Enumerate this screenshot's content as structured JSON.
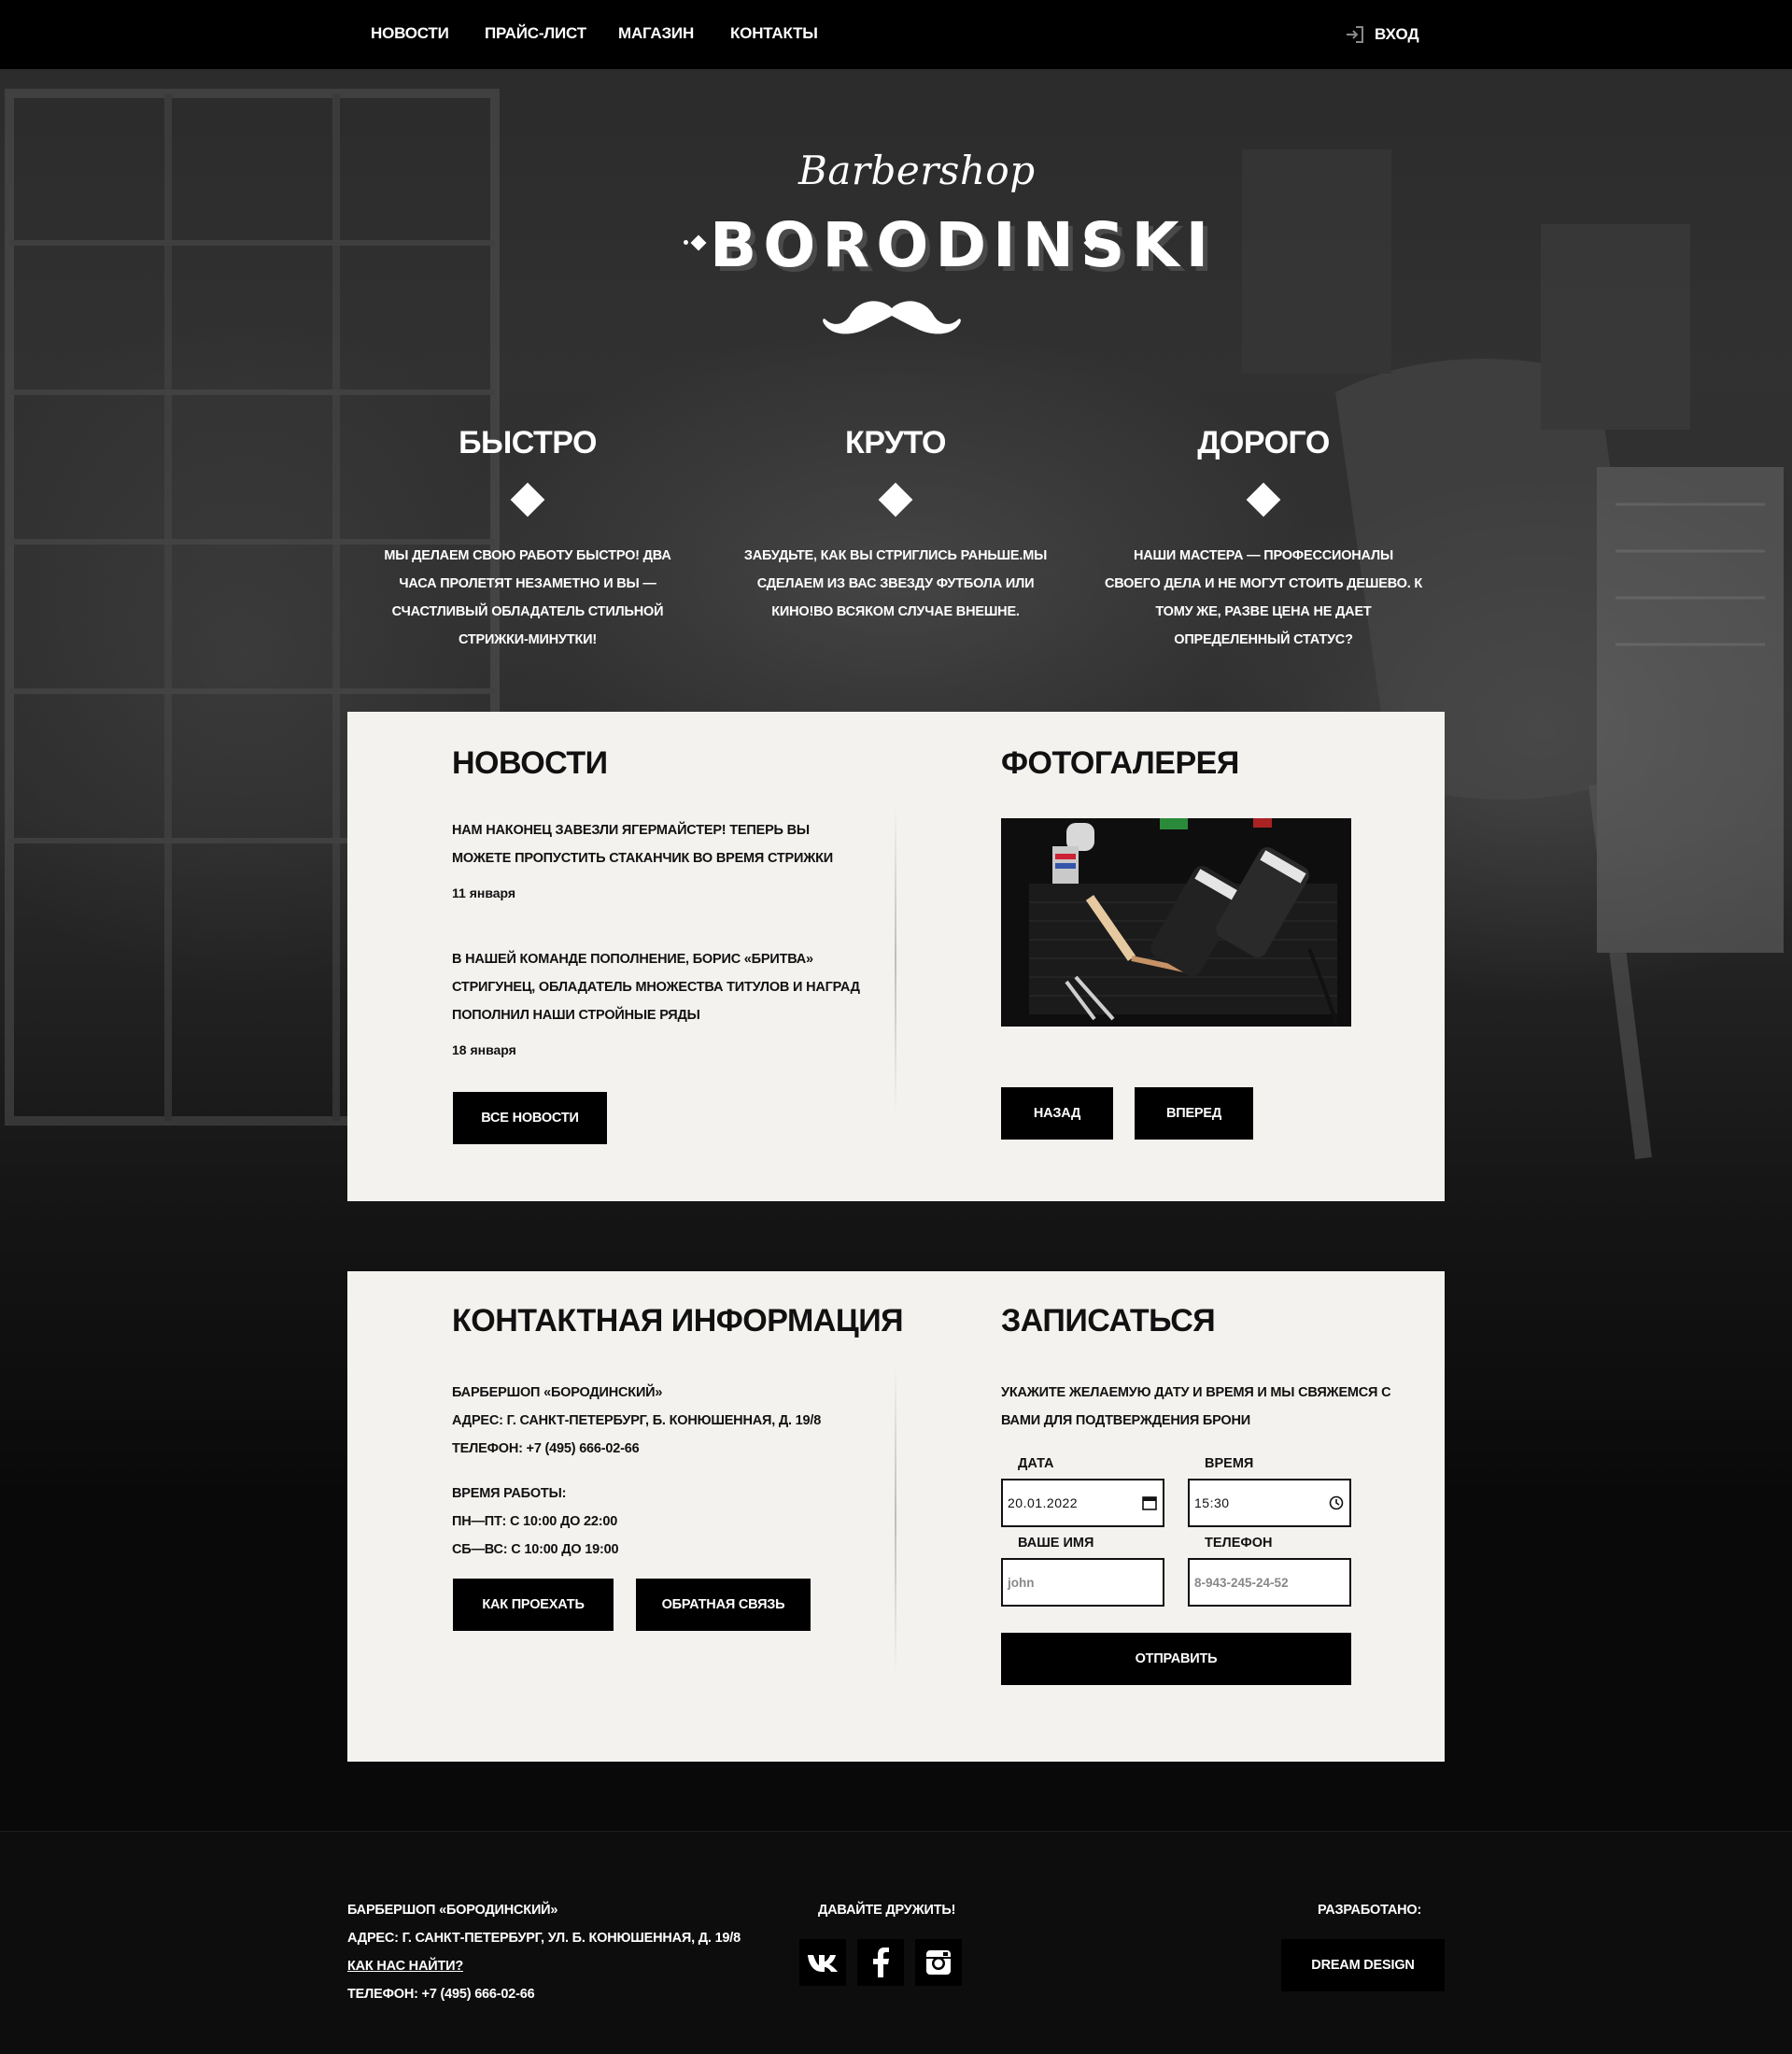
{
  "nav": {
    "links": [
      "НОВОСТИ",
      "ПРАЙС-ЛИСТ",
      "МАГАЗИН",
      "КОНТАКТЫ"
    ],
    "login_label": "ВХОД"
  },
  "logo": {
    "script_text": "Barbershop",
    "main_text": "BORODINSKI"
  },
  "features": [
    {
      "title": "БЫСТРО",
      "text": "МЫ ДЕЛАЕМ СВОЮ РАБОТУ БЫСТРО! ДВА ЧАСА ПРОЛЕТЯТ НЕЗАМЕТНО И ВЫ — СЧАСТЛИВЫЙ ОБЛАДАТЕЛЬ СТИЛЬНОЙ СТРИЖКИ-МИНУТКИ!"
    },
    {
      "title": "КРУТО",
      "text": "ЗАБУДЬТЕ, КАК ВЫ СТРИГЛИСЬ РАНЬШЕ.МЫ СДЕЛАЕМ ИЗ ВАС ЗВЕЗДУ ФУТБОЛА ИЛИ КИНО!ВО ВСЯКОМ СЛУЧАЕ ВНЕШНЕ."
    },
    {
      "title": "ДОРОГО",
      "text": "НАШИ МАСТЕРА — ПРОФЕССИОНАЛЫ СВОЕГО ДЕЛА И НЕ МОГУТ СТОИТЬ ДЕШЕВО. К ТОМУ ЖЕ, РАЗВЕ ЦЕНА НЕ ДАЕТ ОПРЕДЕЛЕННЫЙ СТАТУС?"
    }
  ],
  "news": {
    "title": "НОВОСТИ",
    "items": [
      {
        "text": "НАМ НАКОНЕЦ ЗАВЕЗЛИ ЯГЕРМАЙСТЕР! ТЕПЕРЬ ВЫ МОЖЕТЕ ПРОПУСТИТЬ СТАКАНЧИК ВО ВРЕМЯ СТРИЖКИ",
        "date": "11 января"
      },
      {
        "text": "В НАШЕЙ КОМАНДЕ ПОПОЛНЕНИЕ, БОРИС «БРИТВА» СТРИГУНЕЦ, ОБЛАДАТЕЛЬ МНОЖЕСТВА ТИТУЛОВ И НАГРАД ПОПОЛНИЛ НАШИ СТРОЙНЫЕ РЯДЫ",
        "date": "18 января"
      }
    ],
    "all_news_label": "ВСЕ НОВОСТИ"
  },
  "gallery": {
    "title": "ФОТОГАЛЕРЕЯ",
    "prev_label": "НАЗАД",
    "next_label": "ВПЕРЕД"
  },
  "contacts": {
    "title": "КОНТАКТНАЯ ИНФОРМАЦИЯ",
    "name": "БАРБЕРШОП «БОРОДИНСКИЙ»",
    "address": "АДРЕС: Г. САНКТ-ПЕТЕРБУРГ, Б. КОНЮШЕННАЯ, Д. 19/8",
    "phone": "ТЕЛЕФОН: +7 (495) 666-02-66",
    "hours_title": "ВРЕМЯ РАБОТЫ:",
    "hours_weekdays": "ПН—ПТ: С 10:00 ДО 22:00",
    "hours_weekend": "СБ—ВС: С 10:00 ДО 19:00",
    "directions_label": "КАК ПРОЕХАТЬ",
    "feedback_label": "ОБРАТНАЯ СВЯЗЬ"
  },
  "booking": {
    "title": "ЗАПИСАТЬСЯ",
    "intro": "УКАЖИТЕ ЖЕЛАЕМУЮ ДАТУ И ВРЕМЯ И МЫ СВЯЖЕМСЯ С ВАМИ ДЛЯ ПОДТВЕРЖДЕНИЯ БРОНИ",
    "date_label": "ДАТА",
    "date_value": "20.01.2022",
    "time_label": "ВРЕМЯ",
    "time_value": "15:30",
    "name_label": "ВАШЕ ИМЯ",
    "name_placeholder": "john",
    "phone_label": "ТЕЛЕФОН",
    "phone_placeholder": "8-943-245-24-52",
    "submit_label": "ОТПРАВИТЬ"
  },
  "footer": {
    "name": "БАРБЕРШОП «БОРОДИНСКИЙ»",
    "address": "АДРЕС: Г. САНКТ-ПЕТЕРБУРГ, УЛ. Б. КОНЮШЕННАЯ, Д. 19/8",
    "find_us_link": "КАК НАС НАЙТИ?",
    "phone": "ТЕЛЕФОН: +7 (495) 666-02-66",
    "social_title": "ДАВАЙТЕ ДРУЖИТЬ!",
    "social_icons": [
      "vk-icon",
      "facebook-icon",
      "instagram-icon"
    ],
    "developed_title": "РАЗРАБОТАНО:",
    "developer_label": "DREAM DESIGN"
  }
}
